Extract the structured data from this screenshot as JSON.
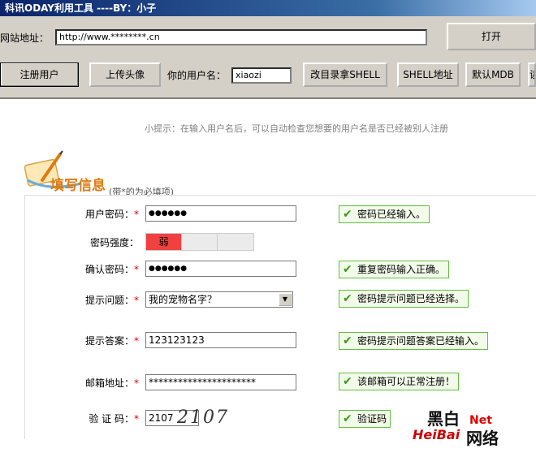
{
  "window": {
    "title": "科讯ODAY利用工具  ----BY：小子"
  },
  "toolbar": {
    "url_label": "网站地址：",
    "url_value": "http://www.********.cn",
    "open_label": "打开",
    "register_label": "注册用户",
    "upload_avatar_label": "上传头像",
    "username_label": "你的用户名：",
    "username_value": "xiaozi",
    "dir_shell_label": "改目录拿SHELL",
    "shell_addr_label": "SHELL地址",
    "default_mdb_label": "默认MDB",
    "cut_off_label": "读"
  },
  "page": {
    "hint": "小提示：在输入用户名后，可以自动检查您想要的用户名是否已经被别人注册",
    "logo_text": "填写信息",
    "required_note": "(带*的为必填项)",
    "required_mark": "*",
    "fields": {
      "password": {
        "label": "用户密码：",
        "value": "●●●●●●",
        "status": "密码已经输入。"
      },
      "strength": {
        "label": "密码强度：",
        "level_text": "弱",
        "level": 1,
        "levels": 3
      },
      "confirm": {
        "label": "确认密码：",
        "value": "●●●●●●",
        "status": "重复密码输入正确。"
      },
      "question": {
        "label": "提示问题：",
        "value": "我的宠物名字？",
        "status": "密码提示问题已经选择。"
      },
      "answer": {
        "label": "提示答案：",
        "value": "123123123",
        "status": "密码提示问题答案已经输入。"
      },
      "email": {
        "label": "邮箱地址：",
        "value": "**********************",
        "status": "该邮箱可以正常注册！"
      },
      "captcha": {
        "label": "验 证 码：",
        "value": "2107",
        "image_text": "2107",
        "status": "验证码"
      }
    }
  },
  "watermark": {
    "line1": "黑白",
    "line2": "Net",
    "line3": "HeiBai",
    "line4": "网络"
  },
  "colors": {
    "ok_border": "#5fbf3f",
    "weak_red": "#f04040",
    "logo_orange": "#e07a10"
  }
}
